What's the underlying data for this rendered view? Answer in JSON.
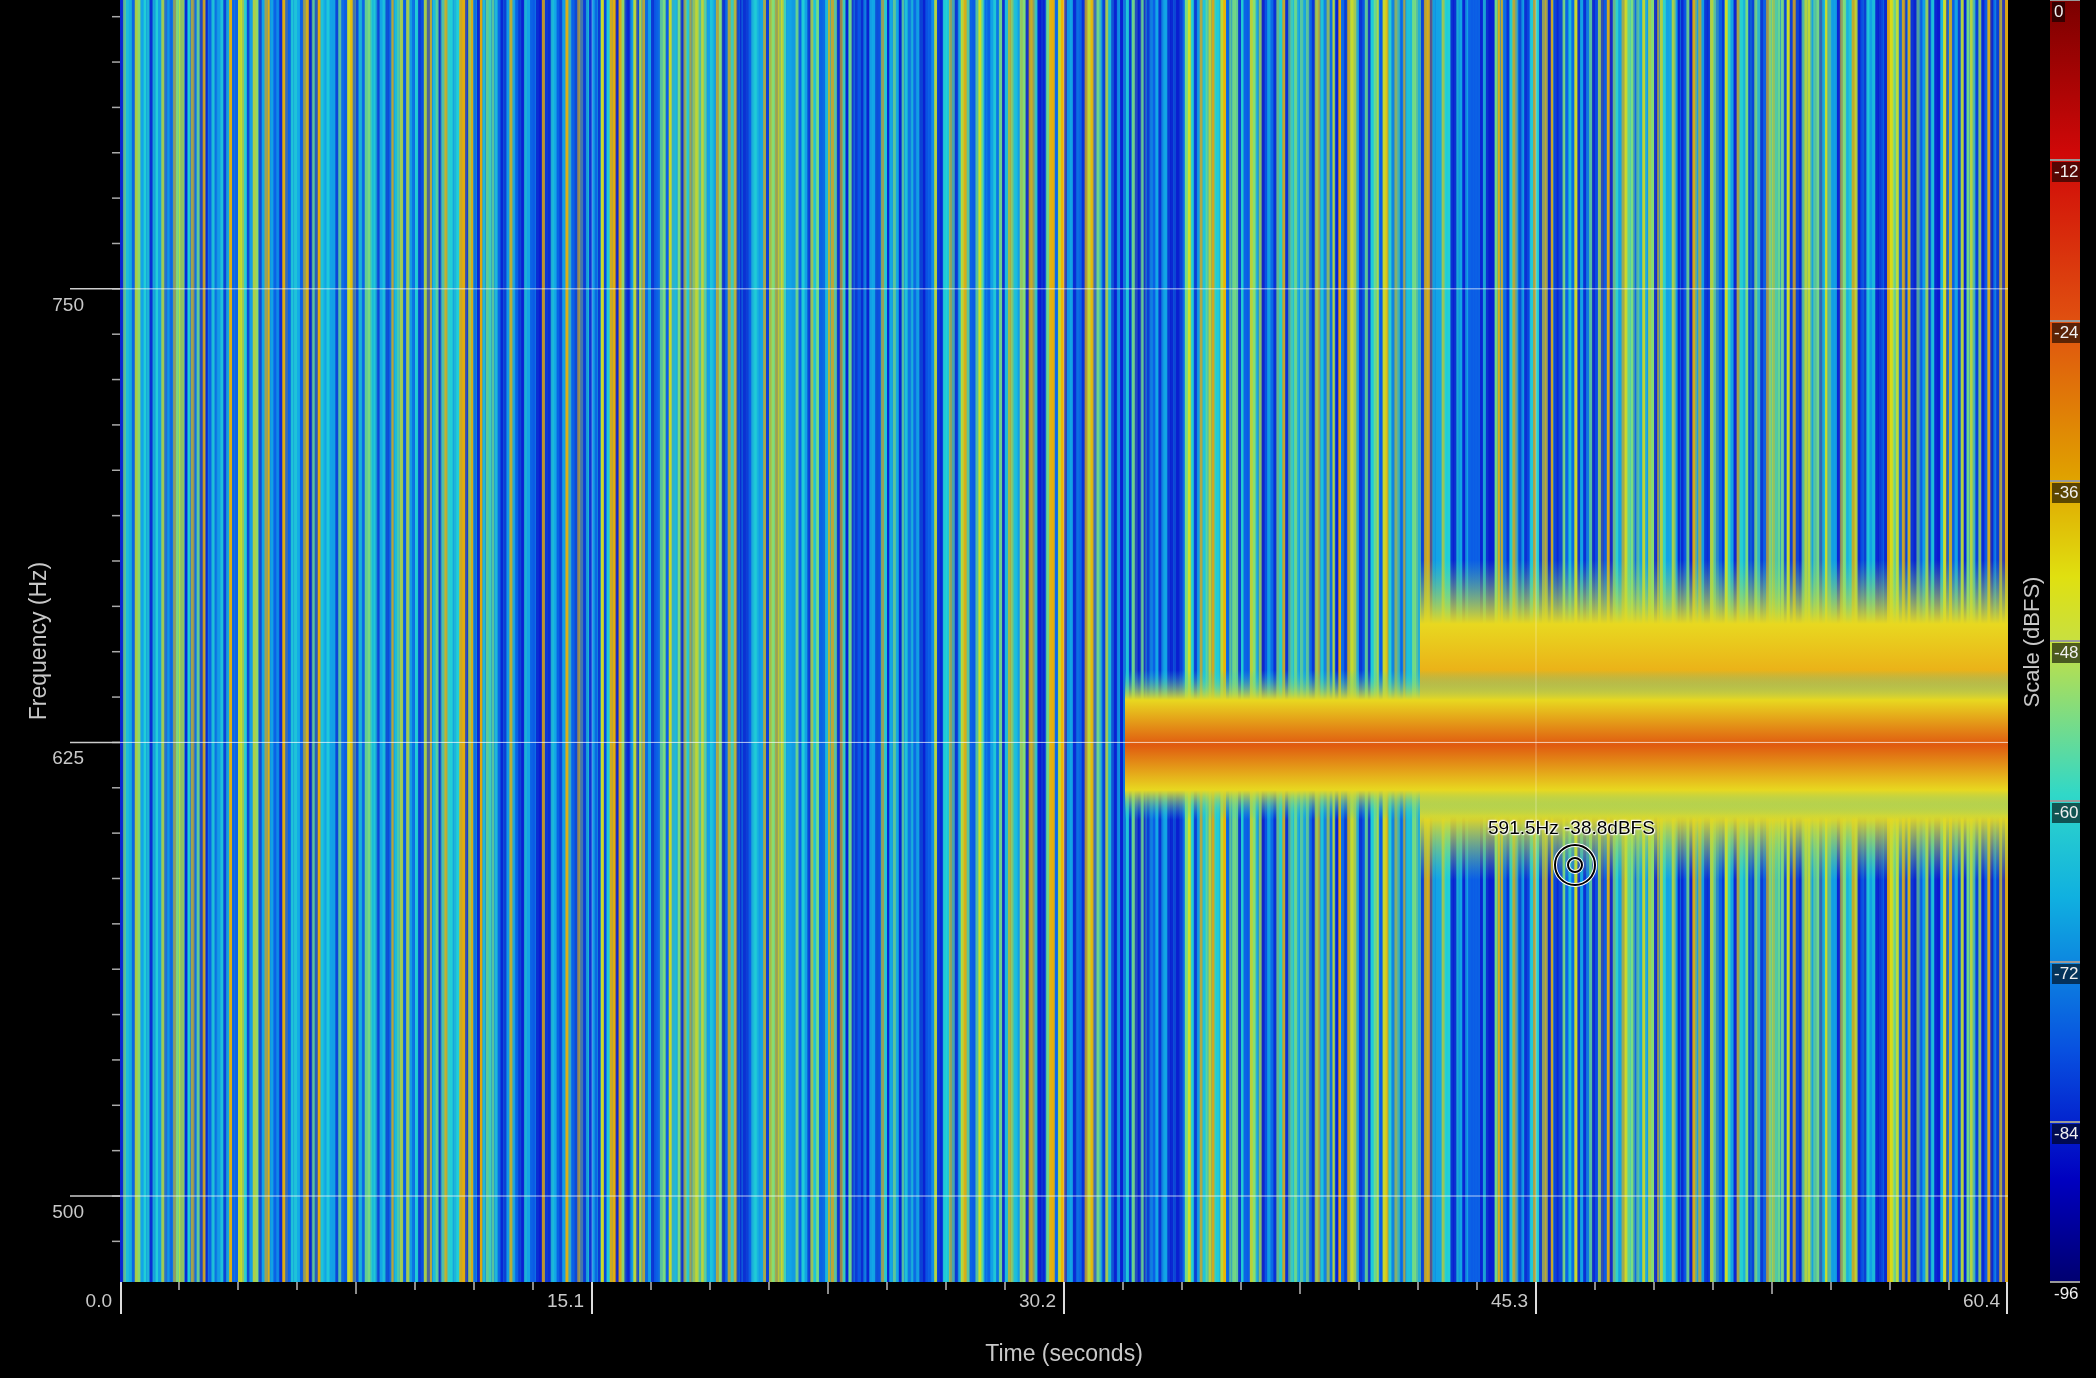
{
  "plot": {
    "y_axis": {
      "title": "Frequency (Hz)",
      "ticks": [
        {
          "label": "750"
        },
        {
          "label": "625"
        },
        {
          "label": "500"
        }
      ]
    },
    "x_axis": {
      "title": "Time (seconds)",
      "ticks": [
        {
          "label": "0.0"
        },
        {
          "label": "15.1"
        },
        {
          "label": "30.2"
        },
        {
          "label": "45.3"
        },
        {
          "label": "60.4"
        }
      ]
    },
    "cursor_readout": "591.5Hz -38.8dBFS"
  },
  "color_scale": {
    "title": "Scale (dBFS)",
    "ticks": [
      {
        "label": "0"
      },
      {
        "label": "-12"
      },
      {
        "label": "-24"
      },
      {
        "label": "-36"
      },
      {
        "label": "-48"
      },
      {
        "label": "-60"
      },
      {
        "label": "-72"
      },
      {
        "label": "-84"
      },
      {
        "label": "-96"
      }
    ]
  }
}
